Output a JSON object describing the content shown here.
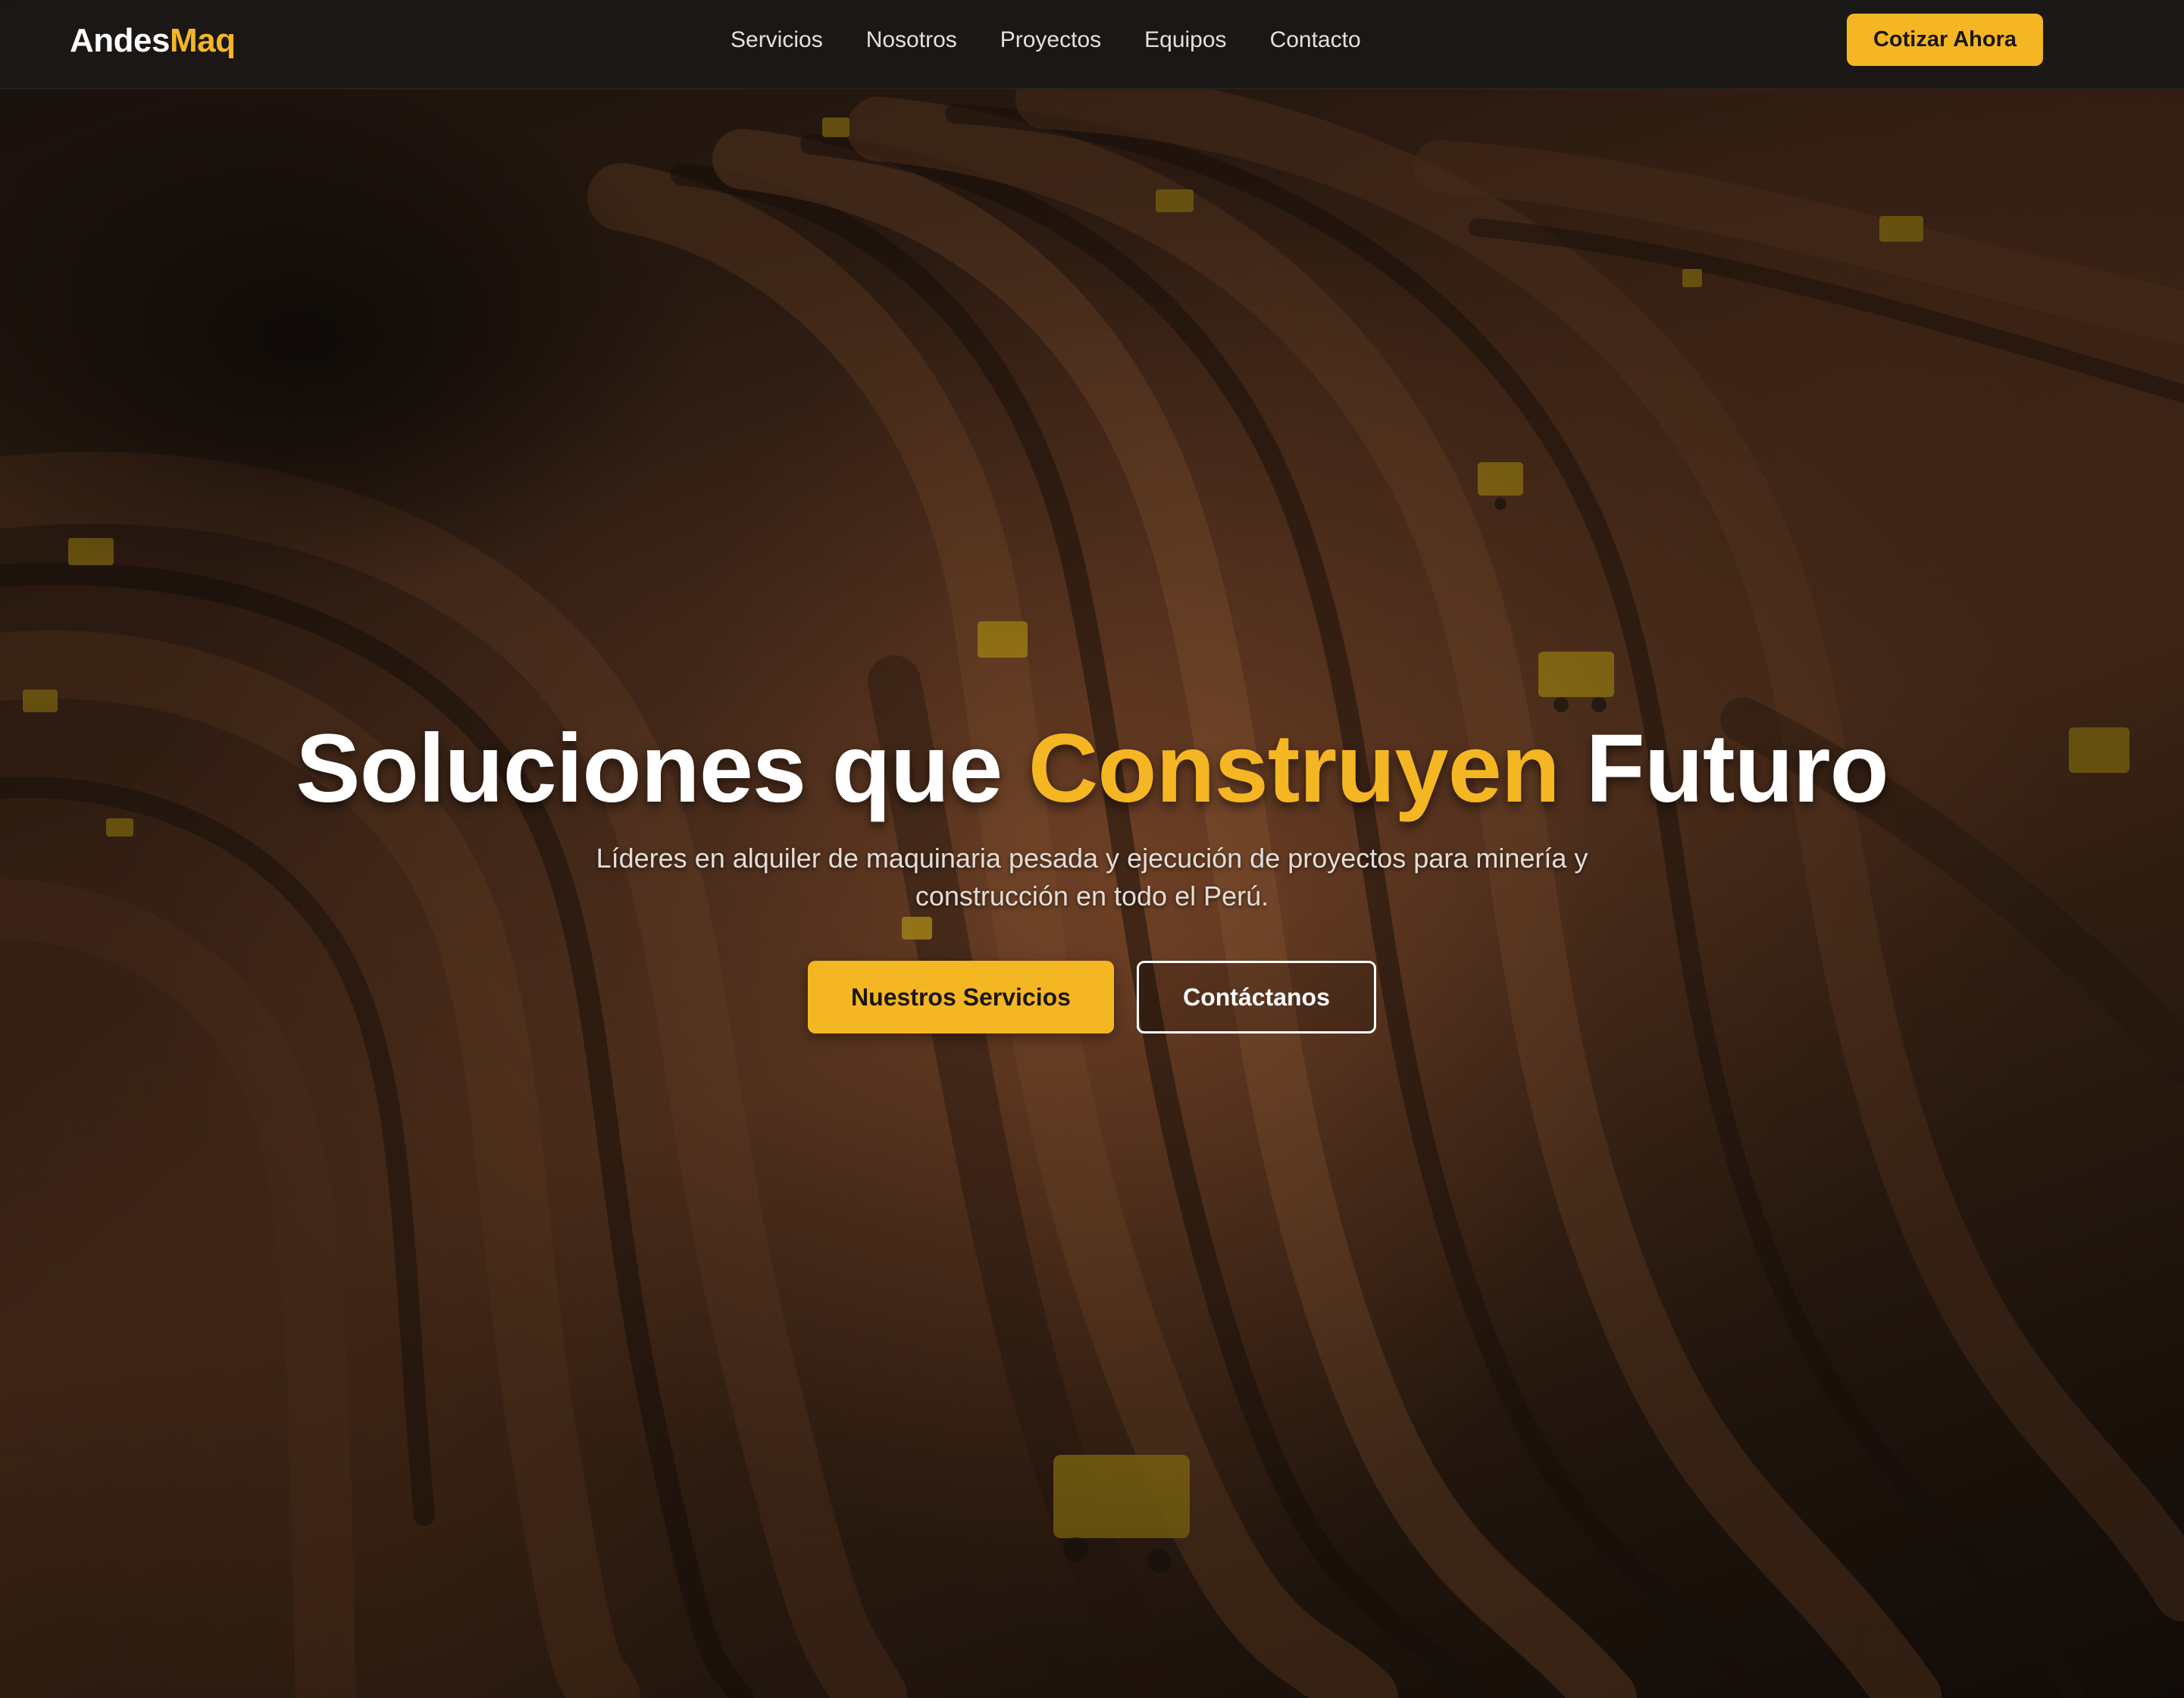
{
  "brand": {
    "name_part1": "Andes",
    "name_part2": "Maq"
  },
  "nav": {
    "links": [
      {
        "label": "Servicios"
      },
      {
        "label": "Nosotros"
      },
      {
        "label": "Proyectos"
      },
      {
        "label": "Equipos"
      },
      {
        "label": "Contacto"
      }
    ],
    "cta_label": "Cotizar Ahora"
  },
  "hero": {
    "title_part1": "Soluciones que ",
    "title_accent": "Construyen",
    "title_part2": " Futuro",
    "subtitle": "Líderes en alquiler de maquinaria pesada y ejecución de proyectos para minería y construcción en todo el Perú.",
    "primary_button": "Nuestros Servicios",
    "secondary_button": "Contáctanos"
  },
  "colors": {
    "accent": "#f5b623",
    "navbar_bg": "#1a1816",
    "text_light": "#ffffff"
  }
}
